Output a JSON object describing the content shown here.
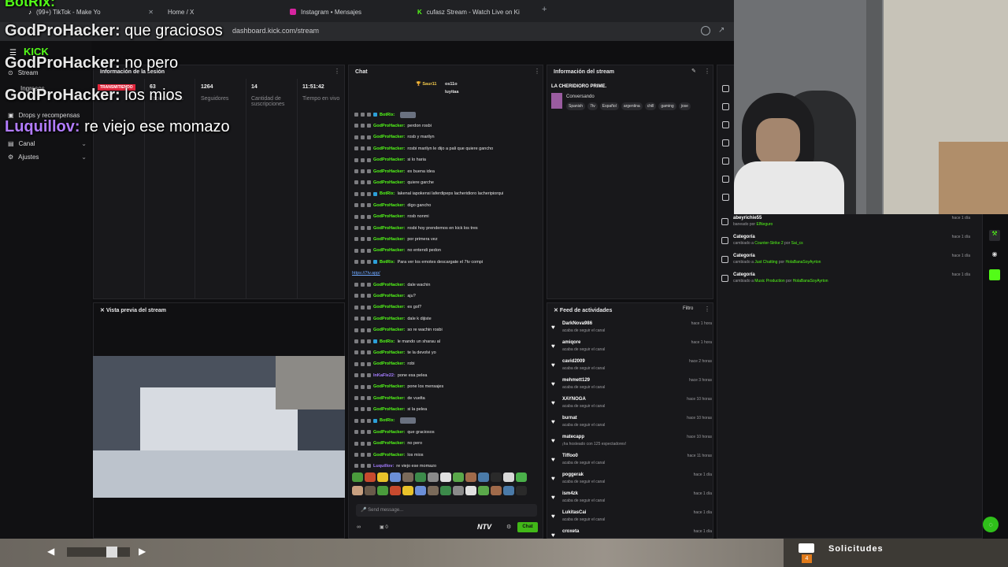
{
  "browser": {
    "tabs": [
      {
        "label": "(99+) TikTok - Make Yo"
      },
      {
        "label": "Home / X"
      },
      {
        "label": "Instagram • Mensajes"
      },
      {
        "label": "cufasz Stream - Watch Live on Ki"
      }
    ],
    "url": "dashboard.kick.com/stream"
  },
  "overlay": {
    "top_name": "BotRix:",
    "messages": [
      {
        "user": "GodProHacker:",
        "text": "que graciosos"
      },
      {
        "user": "GodProHacker:",
        "text": "no pero"
      },
      {
        "user": "GodProHacker:",
        "text": "los mios"
      },
      {
        "user": "Luquillov:",
        "text": "re viejo ese momazo"
      }
    ]
  },
  "sidebar": {
    "logo": "KICK",
    "items": [
      {
        "label": "Stream"
      },
      {
        "label": "Ingresos"
      },
      {
        "label": "Drops y recompensas"
      },
      {
        "label": "Canal"
      },
      {
        "label": "Ajustes"
      }
    ]
  },
  "stream_info_panel": {
    "title": "Información de la sesión",
    "live_badge": "TRANSMITIENDO",
    "stats": [
      {
        "value": "63",
        "label": "Espectadores"
      },
      {
        "value": "1264",
        "label": "Seguidores"
      },
      {
        "value": "14",
        "label": "Cantidad de suscripciones"
      },
      {
        "value": "11:51:42",
        "label": "Tiempo en vivo"
      }
    ]
  },
  "preview": {
    "title": "Vista previa del stream"
  },
  "chat": {
    "title": "Chat",
    "top_users": [
      {
        "name": "Saur11",
        "count": "3"
      },
      {
        "name": "os11o",
        "count": "1"
      },
      {
        "name": "luyitaa",
        "count": "1"
      }
    ],
    "messages": [
      {
        "user": "BotRix:",
        "text": "",
        "bot": true,
        "emote": true
      },
      {
        "user": "GodProHacker:",
        "text": "perdon rosbi"
      },
      {
        "user": "GodProHacker:",
        "text": "rosb y marilyn"
      },
      {
        "user": "GodProHacker:",
        "text": "rosbi marilyn le dijo a pali que quiere gancho"
      },
      {
        "user": "GodProHacker:",
        "text": "si lo haria"
      },
      {
        "user": "GodProHacker:",
        "text": "es buena idea"
      },
      {
        "user": "GodProHacker:",
        "text": "quiere garche"
      },
      {
        "user": "BotRix:",
        "text": "lakenal iapokensi laferdipeps lacheridioro lacheripiorqui",
        "bot": true
      },
      {
        "user": "GodProHacker:",
        "text": "digo gancho"
      },
      {
        "user": "GodProHacker:",
        "text": "rosb nonmi"
      },
      {
        "user": "GodProHacker:",
        "text": "rosbi hoy prendemos en kick los tres"
      },
      {
        "user": "GodProHacker:",
        "text": "por primera vez"
      },
      {
        "user": "GodProHacker:",
        "text": "no entendi pedon"
      },
      {
        "user": "BotRix:",
        "text": "Para ver los emotes descargate el 7tv compi",
        "bot": true
      },
      {
        "user": "",
        "text": "https://7tv.app/"
      },
      {
        "user": "GodProHacker:",
        "text": "dale wachin"
      },
      {
        "user": "GodProHacker:",
        "text": "aju?"
      },
      {
        "user": "GodProHacker:",
        "text": "es gol?"
      },
      {
        "user": "GodProHacker:",
        "text": "dale k dijiste"
      },
      {
        "user": "GodProHacker:",
        "text": "so re wachin rosbi"
      },
      {
        "user": "BotRix:",
        "text": "le mando un sharau al",
        "bot": true
      },
      {
        "user": "GodProHacker:",
        "text": "te la devolvi yo"
      },
      {
        "user": "GodProHacker:",
        "text": "robi"
      },
      {
        "user": "InKaFle22:",
        "text": "pone esa pelea",
        "alt": true
      },
      {
        "user": "GodProHacker:",
        "text": "pone los mensajes"
      },
      {
        "user": "GodProHacker:",
        "text": "de vuelta"
      },
      {
        "user": "GodProHacker:",
        "text": "si la pelea"
      },
      {
        "user": "BotRix:",
        "text": "",
        "bot": true,
        "emote": true
      },
      {
        "user": "GodProHacker:",
        "text": "que graciosos"
      },
      {
        "user": "GodProHacker:",
        "text": "no pero"
      },
      {
        "user": "GodProHacker:",
        "text": "los mios"
      },
      {
        "user": "Luquillov:",
        "text": "re viejo ese momazo",
        "alt": true
      }
    ],
    "input_placeholder": "Send message...",
    "count": "0",
    "ntv": "NTV",
    "send_label": "Chat"
  },
  "stream_details": {
    "title": "Información del stream",
    "stream_title": "LA CHERIDIORO PRIME.",
    "category": "Conversando",
    "tags": [
      "Spanish",
      "7tv",
      "Español",
      "argentina",
      "chill",
      "gaming",
      "jose"
    ]
  },
  "activity": {
    "title": "Feed de actividades",
    "filter": "Filtro",
    "items": [
      {
        "name": "DarkNova986",
        "desc": "acaba de seguir el canal",
        "time": "hace 1 hora"
      },
      {
        "name": "amiqore",
        "desc": "acaba de seguir el canal",
        "time": "hace 1 hora"
      },
      {
        "name": "cavid2009",
        "desc": "acaba de seguir el canal",
        "time": "hace 2 horas"
      },
      {
        "name": "mehmett129",
        "desc": "acaba de seguir el canal",
        "time": "hace 3 horas"
      },
      {
        "name": "XAYNOGA",
        "desc": "acaba de seguir el canal",
        "time": "hace 10 horas"
      },
      {
        "name": "burnat",
        "desc": "acaba de seguir el canal",
        "time": "hace 10 horas"
      },
      {
        "name": "matecapp",
        "desc": "¡ha hosteado con 125 espectadores!",
        "time": "hace 10 horas"
      },
      {
        "name": "Tiffoo0",
        "desc": "acaba de seguir el canal",
        "time": "hace 11 horas"
      },
      {
        "name": "poggerak",
        "desc": "acaba de seguir el canal",
        "time": "hace 1 día"
      },
      {
        "name": "ism4zk",
        "desc": "acaba de seguir el canal",
        "time": "hace 1 día"
      },
      {
        "name": "LukitasCai",
        "desc": "acaba de seguir el canal",
        "time": "hace 1 día"
      },
      {
        "name": "croxeta",
        "desc": "",
        "time": "hace 1 día"
      }
    ]
  },
  "mod_log": {
    "items": [
      {
        "title": "abeyrichie55",
        "pre": "baneado por",
        "who": "ElNeguro",
        "mid": "",
        "who2": "",
        "time": "hace 1 día"
      },
      {
        "title": "Categoría",
        "pre": "cambiado a",
        "who": "Counter-Strike 2",
        "mid": "por",
        "who2": "Sai_cs",
        "time": "hace 1 día"
      },
      {
        "title": "Categoría",
        "pre": "cambiado a",
        "who": "Just Chatting",
        "mid": "por",
        "who2": "HolaBanaSoyAyrton",
        "time": "hace 1 día"
      },
      {
        "title": "Categoría",
        "pre": "cambiado a",
        "who": "Music Production",
        "mid": "por",
        "who2": "HolaBanaSoyAyrton",
        "time": "hace 1 día"
      }
    ]
  },
  "taskbar": {
    "label": "Solicitudes",
    "badge": "4"
  }
}
